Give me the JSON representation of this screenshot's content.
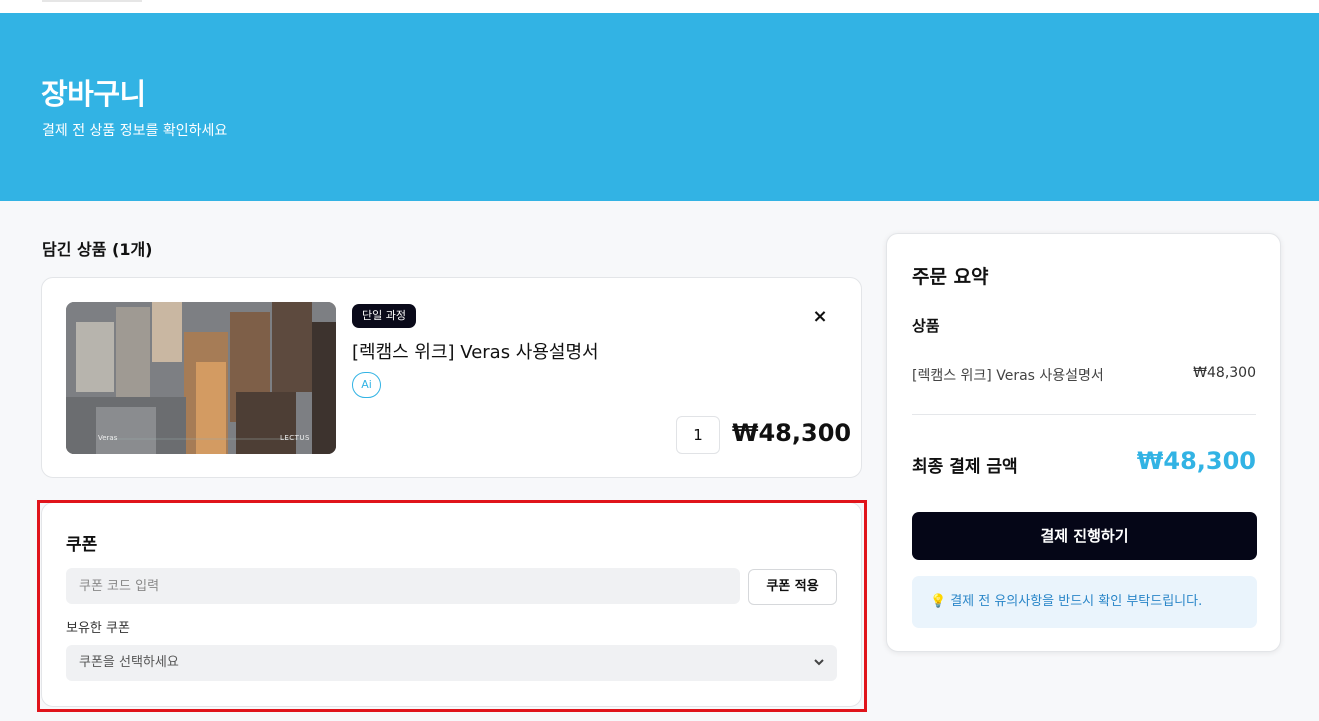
{
  "hero": {
    "title": "장바구니",
    "subtitle": "결제 전 상품 정보를 확인하세요"
  },
  "cart": {
    "section_title": "담긴 상품 (1개)",
    "item": {
      "badge": "단일 과정",
      "title": "[렉캠스 위크] Veras 사용설명서",
      "tag": "Ai",
      "thumb_label_left": "Veras",
      "thumb_label_right": "LECTUS",
      "quantity": "1",
      "price": "₩48,300",
      "remove_icon": "×"
    }
  },
  "coupon": {
    "title": "쿠폰",
    "input_placeholder": "쿠폰 코드 입력",
    "apply_label": "쿠폰 적용",
    "owned_label": "보유한 쿠폰",
    "select_placeholder": "쿠폰을 선택하세요"
  },
  "summary": {
    "title": "주문 요약",
    "products_label": "상품",
    "line_item_name": "[렉캠스 위크] Veras 사용설명서",
    "line_item_price": "₩48,300",
    "total_label": "최종 결제 금액",
    "total_value": "₩48,300",
    "pay_button": "결제 진행하기",
    "notice": "결제 전 유의사항을 반드시 확인 부탁드립니다."
  },
  "colors": {
    "brand": "#32b3e4",
    "dark": "#050617",
    "highlight": "#e0141b"
  },
  "icons": {
    "close": "close-icon",
    "chevron": "chevron-down-icon",
    "bulb": "lightbulb-icon"
  }
}
